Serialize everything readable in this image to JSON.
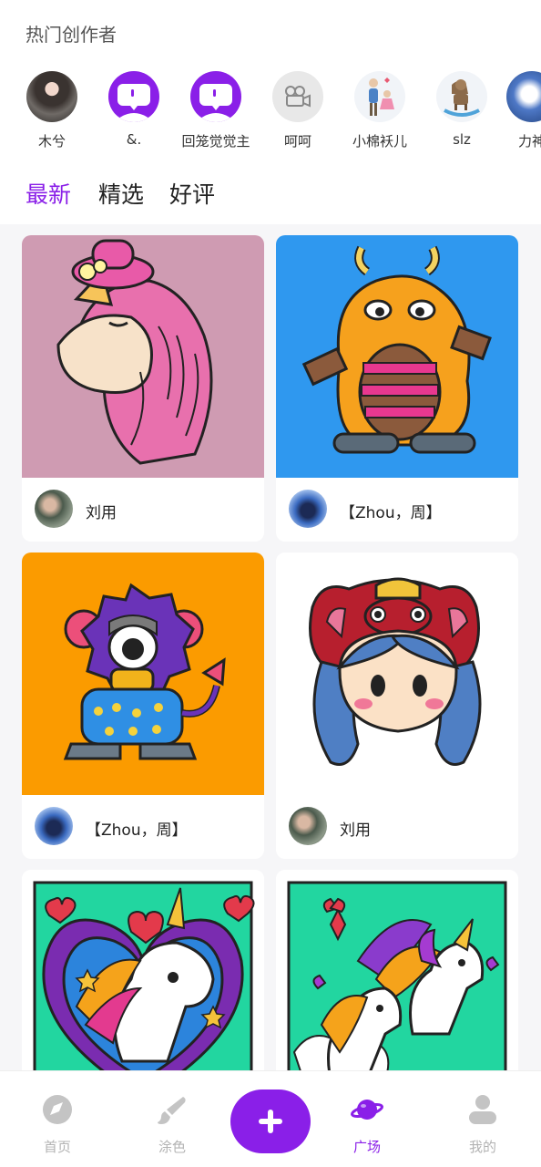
{
  "hot_creators": {
    "title": "热门创作者",
    "items": [
      {
        "name": "木兮"
      },
      {
        "name": "&."
      },
      {
        "name": "回笼觉觉主"
      },
      {
        "name": "呵呵"
      },
      {
        "name": "小棉袄儿"
      },
      {
        "name": "slz"
      },
      {
        "name": "力神"
      }
    ]
  },
  "tabs": [
    {
      "label": "最新",
      "active": true
    },
    {
      "label": "精选",
      "active": false
    },
    {
      "label": "好评",
      "active": false
    }
  ],
  "feed": [
    {
      "artwork": "unicorn-with-pink-hat",
      "author": "刘用"
    },
    {
      "artwork": "orange-monster",
      "author": "【Zhou，周】"
    },
    {
      "artwork": "purple-cyclops-monster",
      "author": "【Zhou，周】"
    },
    {
      "artwork": "girl-in-red-hood",
      "author": "刘用"
    },
    {
      "artwork": "unicorn-heart",
      "author": ""
    },
    {
      "artwork": "pegasus-unicorns",
      "author": ""
    }
  ],
  "bottom_nav": {
    "items": [
      {
        "label": "首页",
        "icon": "compass-icon"
      },
      {
        "label": "涂色",
        "icon": "brush-icon"
      },
      {
        "label": "",
        "icon": "plus-icon"
      },
      {
        "label": "广场",
        "icon": "planet-icon",
        "active": true
      },
      {
        "label": "我的",
        "icon": "user-icon"
      }
    ]
  },
  "colors": {
    "accent": "#8a1fe8",
    "inactive": "#b3b3b3"
  }
}
